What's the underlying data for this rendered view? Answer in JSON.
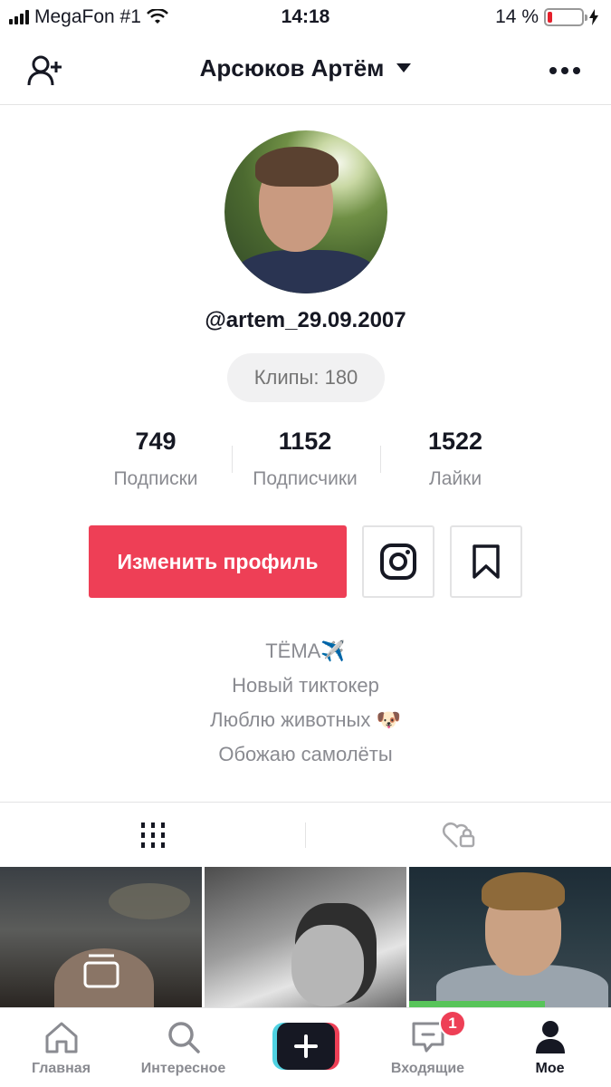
{
  "status_bar": {
    "carrier": "MegaFon #1",
    "time": "14:18",
    "battery_text": "14 %",
    "battery_level": 0.14,
    "battery_color": "#e5202b"
  },
  "header": {
    "title": "Арсюков Артём",
    "add_friend_icon": "person-plus-icon",
    "more_icon": "more-dots-icon"
  },
  "profile": {
    "username": "@artem_29.09.2007",
    "clips_label": "Клипы: 180",
    "stats": [
      {
        "value": "749",
        "label": "Подписки"
      },
      {
        "value": "1152",
        "label": "Подписчики"
      },
      {
        "value": "1522",
        "label": "Лайки"
      }
    ],
    "edit_button": "Изменить профиль",
    "accent_color": "#ee3f56",
    "bio": [
      "ТЁМА✈️",
      "Новый тиктокер",
      "Люблю животных 🐶",
      "Обожаю самолёты"
    ]
  },
  "content_tabs": [
    {
      "icon": "videos-grid-icon",
      "selected": true
    },
    {
      "icon": "liked-locked-icon",
      "selected": false
    }
  ],
  "tab_bar": {
    "items": [
      {
        "label": "Главная",
        "icon": "home-icon"
      },
      {
        "label": "Интересное",
        "icon": "search-icon"
      },
      {
        "label": "",
        "icon": "create-plus-icon"
      },
      {
        "label": "Входящие",
        "icon": "inbox-icon",
        "badge": "1"
      },
      {
        "label": "Мое",
        "icon": "profile-icon",
        "active": true
      }
    ]
  }
}
